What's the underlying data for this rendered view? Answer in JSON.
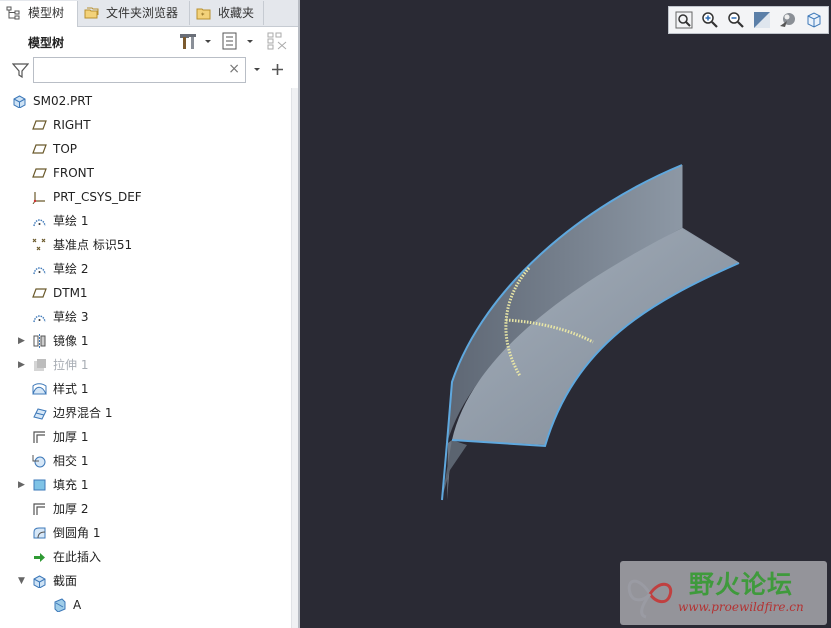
{
  "tabs": [
    {
      "label": "模型树",
      "icon": "model-tree-icon",
      "active": true
    },
    {
      "label": "文件夹浏览器",
      "icon": "folder-browser-icon",
      "active": false
    },
    {
      "label": "收藏夹",
      "icon": "favorites-icon",
      "active": false
    }
  ],
  "toolbar": {
    "title": "模型树"
  },
  "search": {
    "value": "",
    "clear": "×"
  },
  "tree": [
    {
      "label": "SM02.PRT",
      "icon": "part-icon",
      "level": 0,
      "expander": ""
    },
    {
      "label": "RIGHT",
      "icon": "datum-plane-icon",
      "level": 1,
      "expander": ""
    },
    {
      "label": "TOP",
      "icon": "datum-plane-icon",
      "level": 1,
      "expander": ""
    },
    {
      "label": "FRONT",
      "icon": "datum-plane-icon",
      "level": 1,
      "expander": ""
    },
    {
      "label": "PRT_CSYS_DEF",
      "icon": "coordinate-system-icon",
      "level": 1,
      "expander": ""
    },
    {
      "label": "草绘 1",
      "icon": "sketch-icon",
      "level": 1,
      "expander": ""
    },
    {
      "label": "基准点 标识51",
      "icon": "datum-point-icon",
      "level": 1,
      "expander": ""
    },
    {
      "label": "草绘 2",
      "icon": "sketch-icon",
      "level": 1,
      "expander": ""
    },
    {
      "label": "DTM1",
      "icon": "datum-plane-icon",
      "level": 1,
      "expander": ""
    },
    {
      "label": "草绘 3",
      "icon": "sketch-icon",
      "level": 1,
      "expander": ""
    },
    {
      "label": "镜像 1",
      "icon": "mirror-icon",
      "level": 1,
      "expander": "▶"
    },
    {
      "label": "拉伸 1",
      "icon": "extrude-icon",
      "level": 1,
      "expander": "▶",
      "dim": true
    },
    {
      "label": "样式 1",
      "icon": "style-icon",
      "level": 1,
      "expander": ""
    },
    {
      "label": "边界混合 1",
      "icon": "boundary-blend-icon",
      "level": 1,
      "expander": ""
    },
    {
      "label": "加厚 1",
      "icon": "thicken-icon",
      "level": 1,
      "expander": ""
    },
    {
      "label": "相交 1",
      "icon": "intersect-icon",
      "level": 1,
      "expander": ""
    },
    {
      "label": "填充 1",
      "icon": "fill-icon",
      "level": 1,
      "expander": "▶"
    },
    {
      "label": "加厚 2",
      "icon": "thicken-icon",
      "level": 1,
      "expander": ""
    },
    {
      "label": "倒圆角 1",
      "icon": "round-icon",
      "level": 1,
      "expander": ""
    },
    {
      "label": "在此插入",
      "icon": "insert-here-arrow-icon",
      "level": 1,
      "expander": ""
    },
    {
      "label": "截面",
      "icon": "section-folder-icon",
      "level": 1,
      "expander": "▼"
    },
    {
      "label": "A",
      "icon": "section-icon",
      "level": 2,
      "expander": ""
    }
  ],
  "view_toolbar": [
    "refit-icon",
    "zoom-in-icon",
    "zoom-out-icon",
    "repaint-icon",
    "display-style-icon",
    "saved-views-icon"
  ],
  "watermark": {
    "name": "野火论坛",
    "url": "www.proewildfire.cn"
  }
}
